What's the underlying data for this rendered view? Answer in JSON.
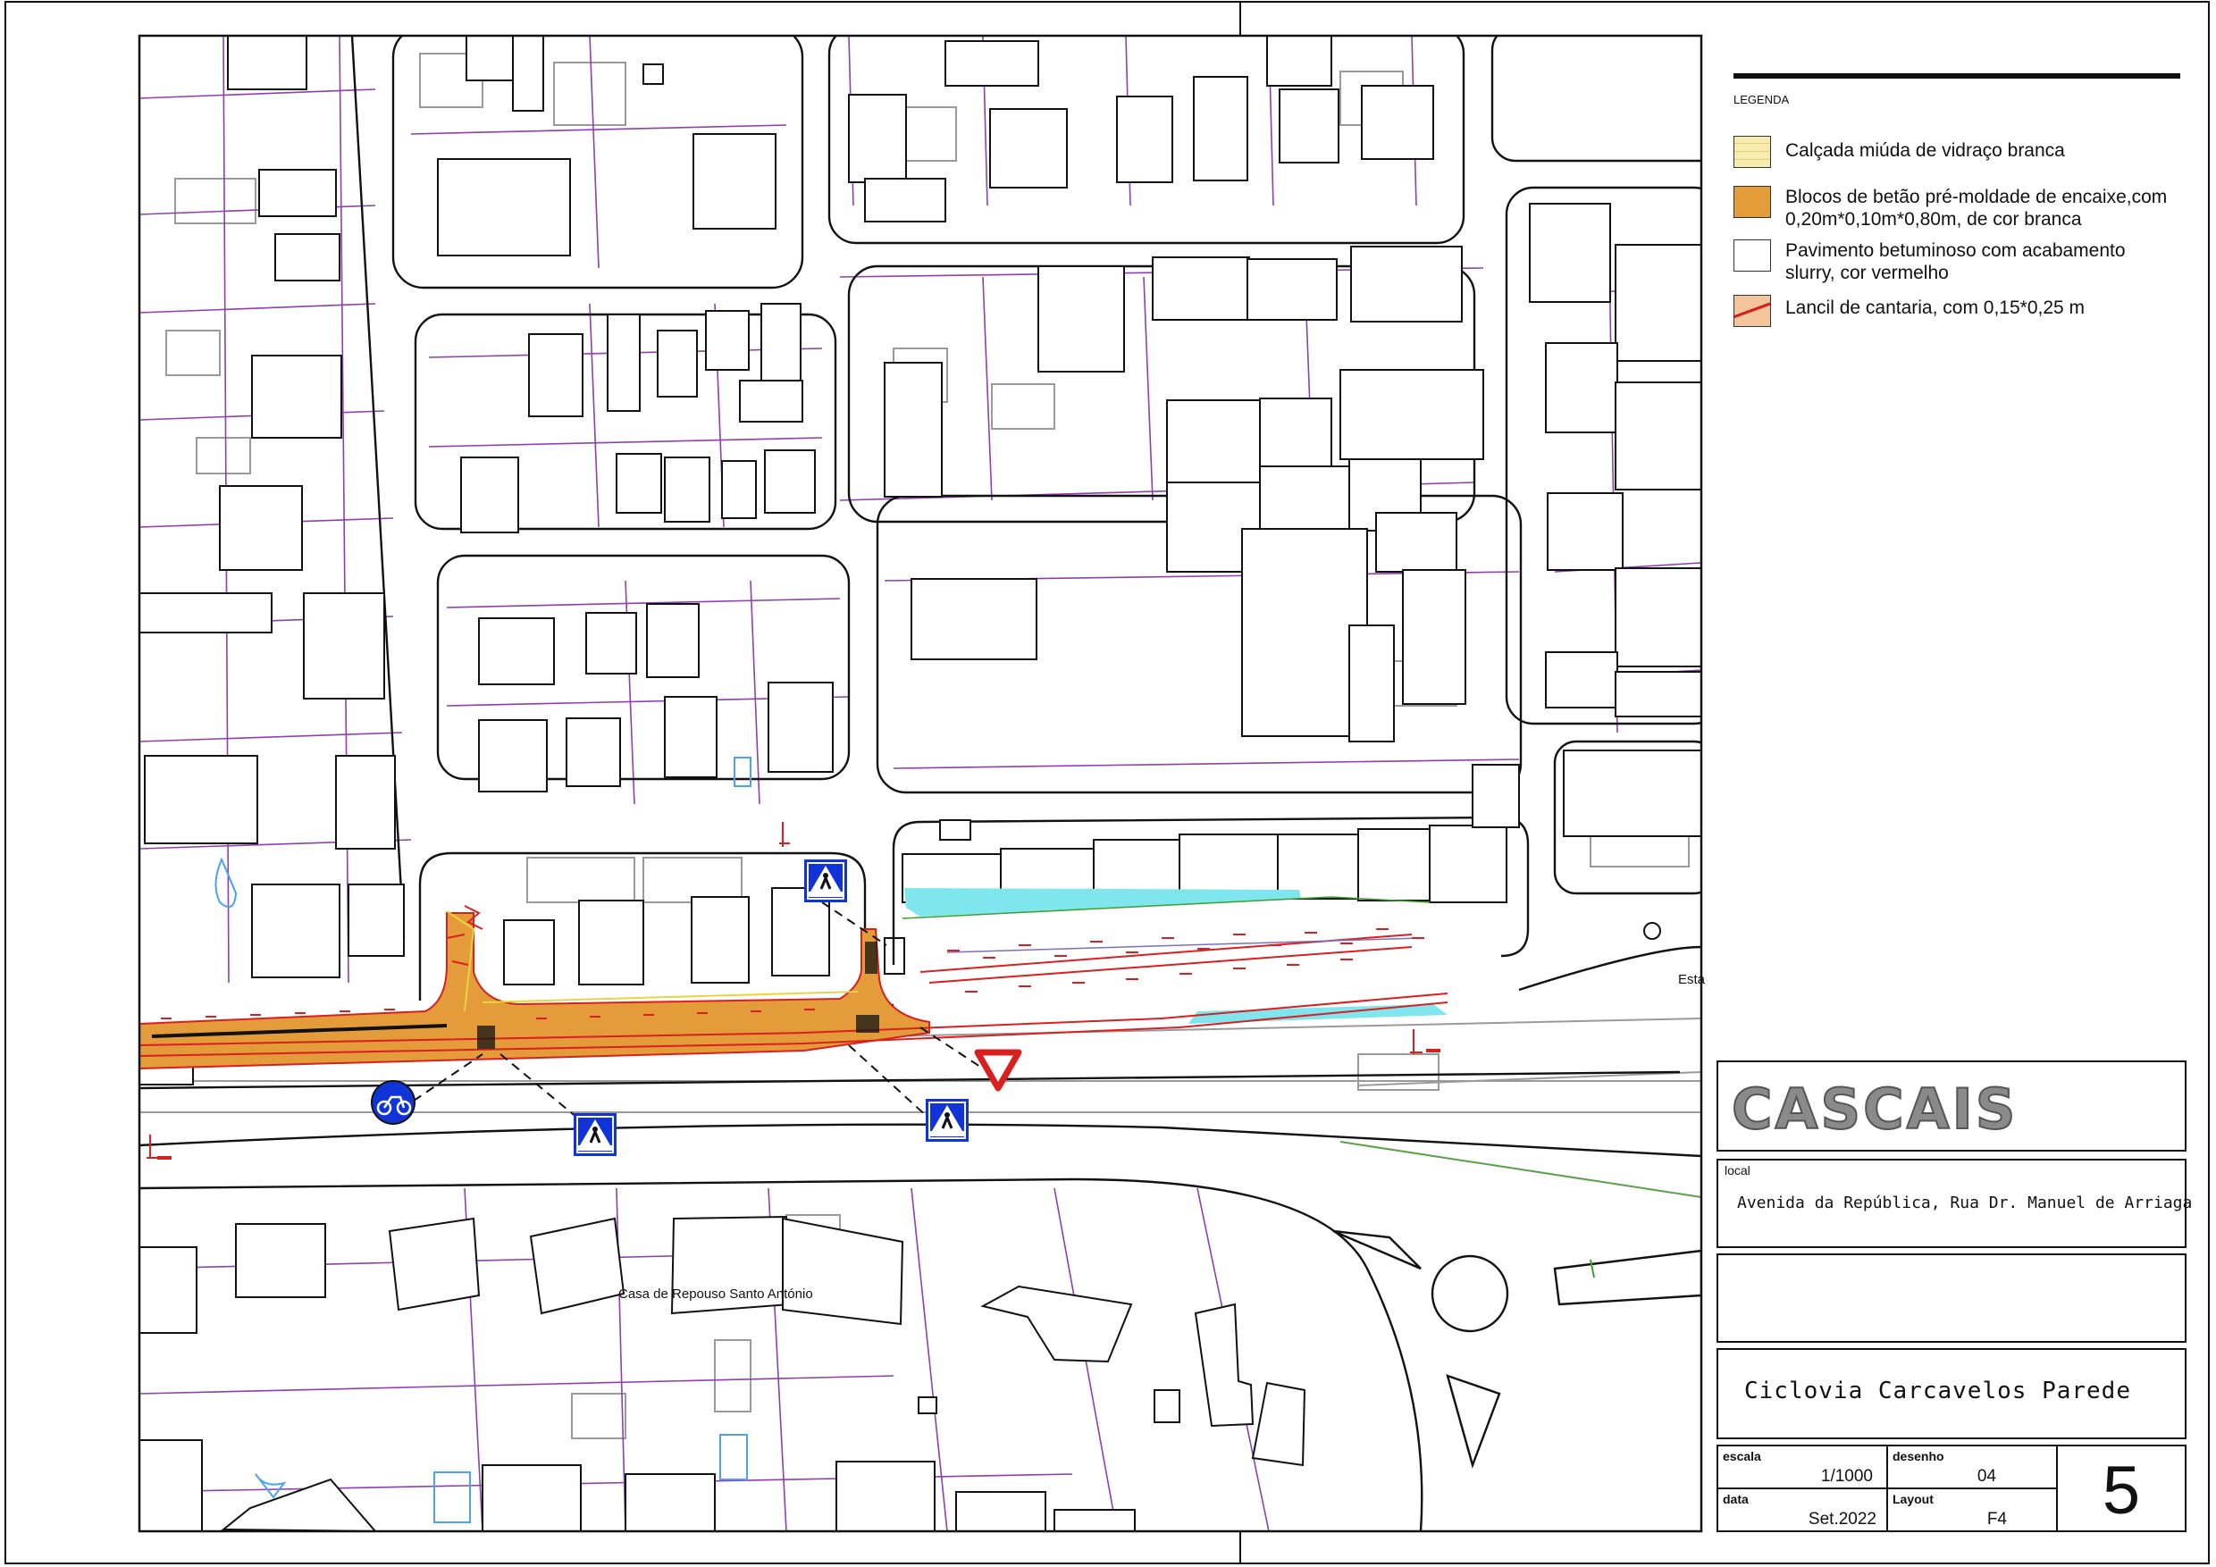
{
  "legend": {
    "title": "LEGENDA",
    "items": [
      {
        "label": "Calçada miúda de vidraço branca",
        "swatch": "#f7ecb0"
      },
      {
        "label": "Blocos de betão pré-moldade de encaixe,com 0,20m*0,10m*0,80m, de cor branca",
        "swatch": "#e49b3a"
      },
      {
        "label": "Pavimento betuminoso com acabamento slurry, cor vermelho",
        "swatch": "#ffffff"
      },
      {
        "label": "Lancil de cantaria, com 0,15*0,25 m",
        "swatch": "#f4c49a"
      }
    ]
  },
  "title_block": {
    "logo": "CASCAIS",
    "local_label": "local",
    "local_value": "Avenida da República, Rua Dr. Manuel de Arriaga",
    "project": "Ciclovia Carcavelos Parede",
    "escala_label": "escala",
    "escala_value": "1/1000",
    "desenho_label": "desenho",
    "desenho_value": "04",
    "data_label": "data",
    "data_value": "Set.2022",
    "layout_label": "Layout",
    "layout_value": "F4",
    "sheet_number": "5"
  },
  "map_labels": {
    "casa": "Casa de Repouso Santo António",
    "esta": "Esta"
  },
  "colors": {
    "building": "#111111",
    "parcel": "#8d3fb0",
    "ghost": "#9a9a9a",
    "bike_red": "#d92020",
    "sidewalk_orange": "#e49b3a",
    "cyan": "#7fe6ee",
    "sign_blue": "#1034d8"
  },
  "icons": [
    "pedestrian-crossing-sign-icon",
    "bicycle-sign-icon",
    "yield-sign-icon"
  ]
}
